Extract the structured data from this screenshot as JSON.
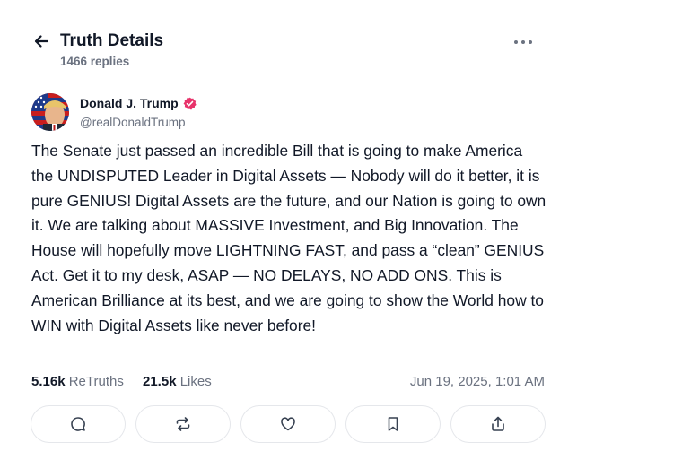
{
  "header": {
    "title": "Truth Details",
    "replies": "1466 replies"
  },
  "author": {
    "name": "Donald J. Trump",
    "handle": "@realDonaldTrump"
  },
  "post": {
    "text": "The Senate just passed an incredible Bill that is going to make America the UNDISPUTED Leader in Digital Assets — Nobody will do it better, it is pure GENIUS! Digital Assets are the future, and our Nation is going to own it. We are talking about MASSIVE Investment, and Big Innovation. The House will hopefully move LIGHTNING FAST, and pass a “clean” GENIUS Act. Get it to my desk, ASAP — NO DELAYS, NO ADD ONS. This is American Brilliance at its best, and we are going to show the World how to WIN with Digital Assets like never before!"
  },
  "stats": {
    "retruths_count": "5.16k",
    "retruths_label": "ReTruths",
    "likes_count": "21.5k",
    "likes_label": "Likes",
    "date": "Jun 19, 2025, 1:01 AM"
  },
  "colors": {
    "verified_badge": "#e8336b",
    "muted_text": "#6b7280",
    "border": "#e5e7eb"
  },
  "icons": [
    "back-arrow-icon",
    "more-dots-icon",
    "verified-badge-icon",
    "reply-icon",
    "retruth-icon",
    "like-icon",
    "bookmark-icon",
    "share-icon"
  ]
}
